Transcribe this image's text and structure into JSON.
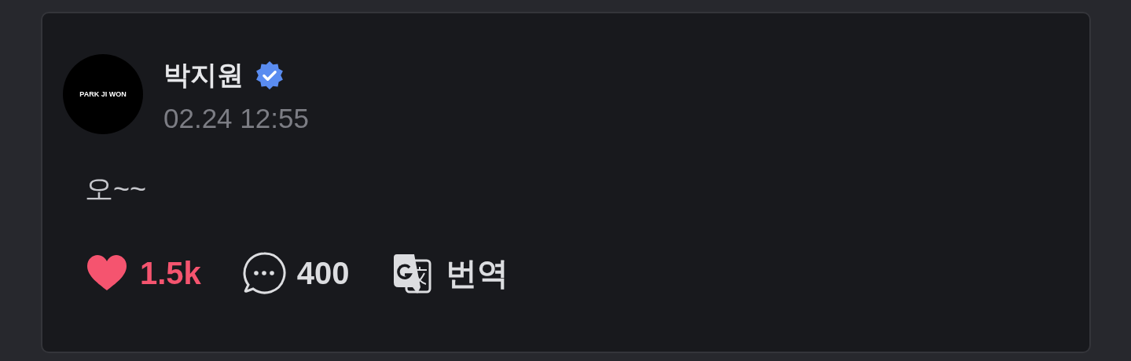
{
  "post": {
    "avatar_text": "PARK JI WON",
    "author": "박지원",
    "verified": true,
    "time": "02.24 12:55",
    "body": "오~~",
    "actions": {
      "likes": "1.5k",
      "liked": true,
      "comments": "400",
      "translate": "번역"
    }
  }
}
